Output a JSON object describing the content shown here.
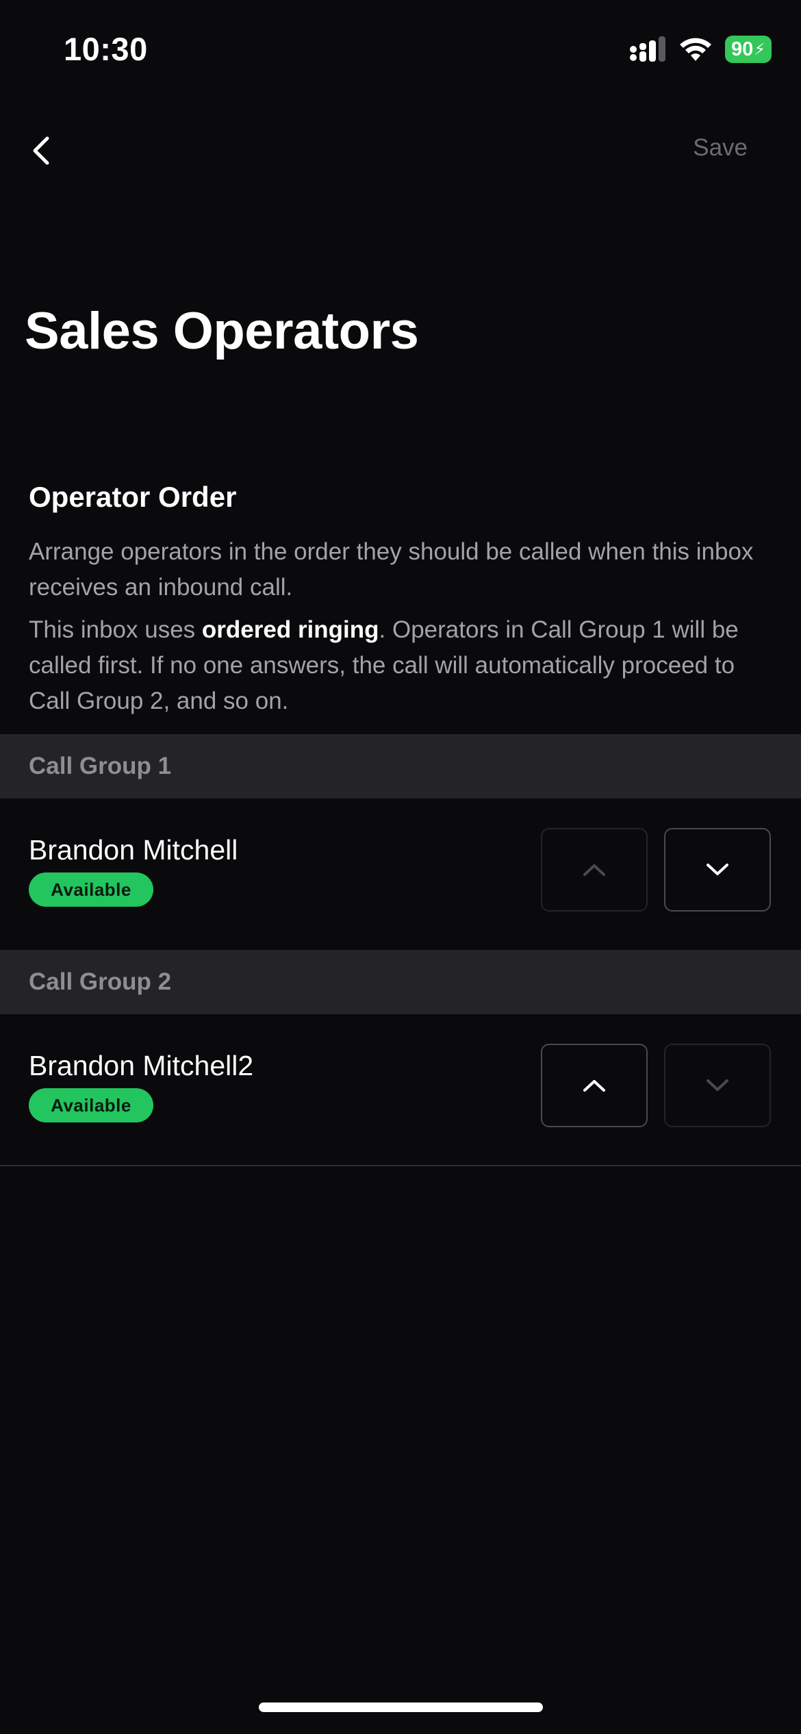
{
  "status_bar": {
    "time": "10:30",
    "battery_level": "90",
    "icons": [
      "signal-icon",
      "wifi-icon",
      "battery-icon"
    ]
  },
  "nav": {
    "back_icon": "chevron-left-icon",
    "save_label": "Save"
  },
  "page_title": "Sales Operators",
  "operator_order": {
    "heading": "Operator Order",
    "description": "Arrange operators in the order they should be called when this inbox receives an inbound call.",
    "ringing_prefix": "This inbox uses ",
    "ringing_mode": "ordered ringing",
    "ringing_suffix": ". Operators in Call Group 1 will be called first. If no one answers, the call will automatically proceed to Call Group 2, and so on."
  },
  "call_groups": [
    {
      "label": "Call Group 1",
      "operators": [
        {
          "name": "Brandon Mitchell",
          "status": "Available",
          "move_up_enabled": false,
          "move_down_enabled": true
        }
      ]
    },
    {
      "label": "Call Group 2",
      "operators": [
        {
          "name": "Brandon Mitchell2",
          "status": "Available",
          "move_up_enabled": true,
          "move_down_enabled": false
        }
      ]
    }
  ],
  "colors": {
    "background": "#0a0a0c",
    "group_header_bg": "#242426",
    "available_badge": "#22c55e",
    "battery": "#34c759",
    "muted_text": "#a3a3a8",
    "save_disabled": "#6c6c70"
  }
}
